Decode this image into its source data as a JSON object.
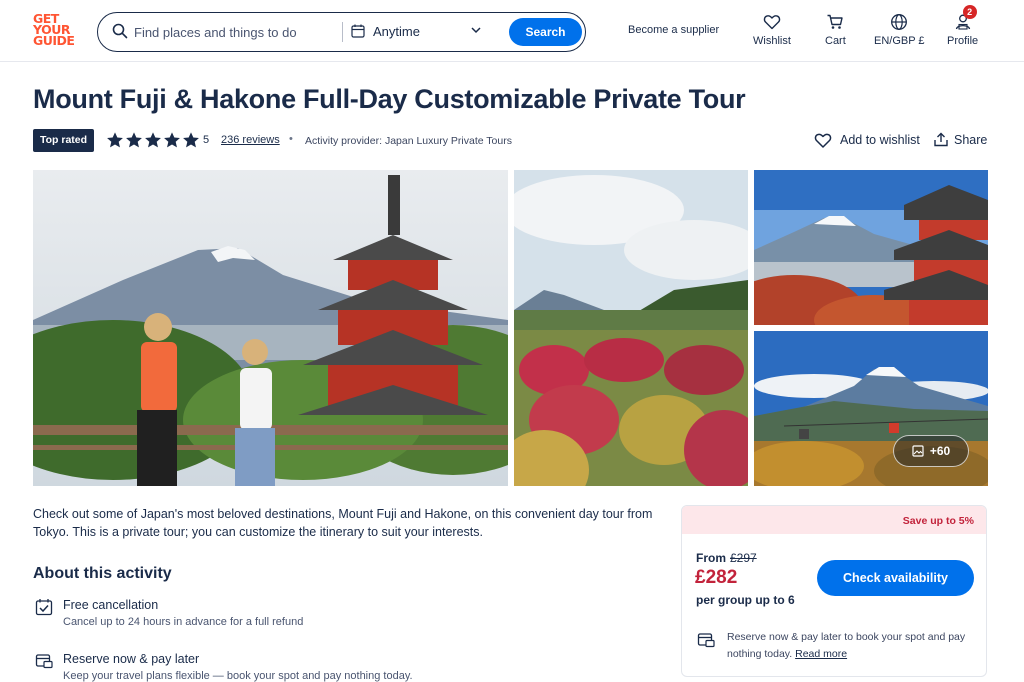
{
  "header": {
    "logo_lines": [
      "GET",
      "YOUR",
      "GUIDE"
    ],
    "search_placeholder": "Find places and things to do",
    "date_label": "Anytime",
    "search_button": "Search",
    "supplier_link": "Become a supplier",
    "nav": {
      "wishlist": "Wishlist",
      "cart": "Cart",
      "language": "EN/GBP £",
      "profile": "Profile",
      "profile_badge": "2"
    }
  },
  "product": {
    "title": "Mount Fuji & Hakone Full-Day Customizable Private Tour",
    "badge": "Top rated",
    "rating": "5",
    "stars": 5,
    "reviews": "236 reviews",
    "separator": "•",
    "provider": "Activity provider: Japan Luxury Private Tours",
    "add_to_wishlist": "Add to wishlist",
    "share": "Share"
  },
  "gallery": {
    "more_photos": "+60"
  },
  "description": "Check out some of Japan's most beloved destinations, Mount Fuji and Hakone, on this convenient day tour from Tokyo. This is a private tour; you can customize the itinerary to suit your interests.",
  "about": {
    "heading": "About this activity",
    "features": [
      {
        "title": "Free cancellation",
        "desc": "Cancel up to 24 hours in advance for a full refund",
        "icon": "calendar-check-icon"
      },
      {
        "title": "Reserve now & pay later",
        "desc": "Keep your travel plans flexible — book your spot and pay nothing today.",
        "icon": "calendar-card-icon"
      }
    ]
  },
  "booking": {
    "save_text": "Save up to 5%",
    "from_label": "From",
    "old_price": "£297",
    "price": "£282",
    "per_group": "per group up to 6",
    "check_button": "Check availability",
    "reserve_text": "Reserve now & pay later to book your spot and pay nothing today.",
    "read_more": "Read more"
  },
  "colors": {
    "brand": "#ff5533",
    "primary": "#0071eb",
    "text": "#1a2b49",
    "price": "#c2233b",
    "save_banner": "#fde7ea"
  }
}
